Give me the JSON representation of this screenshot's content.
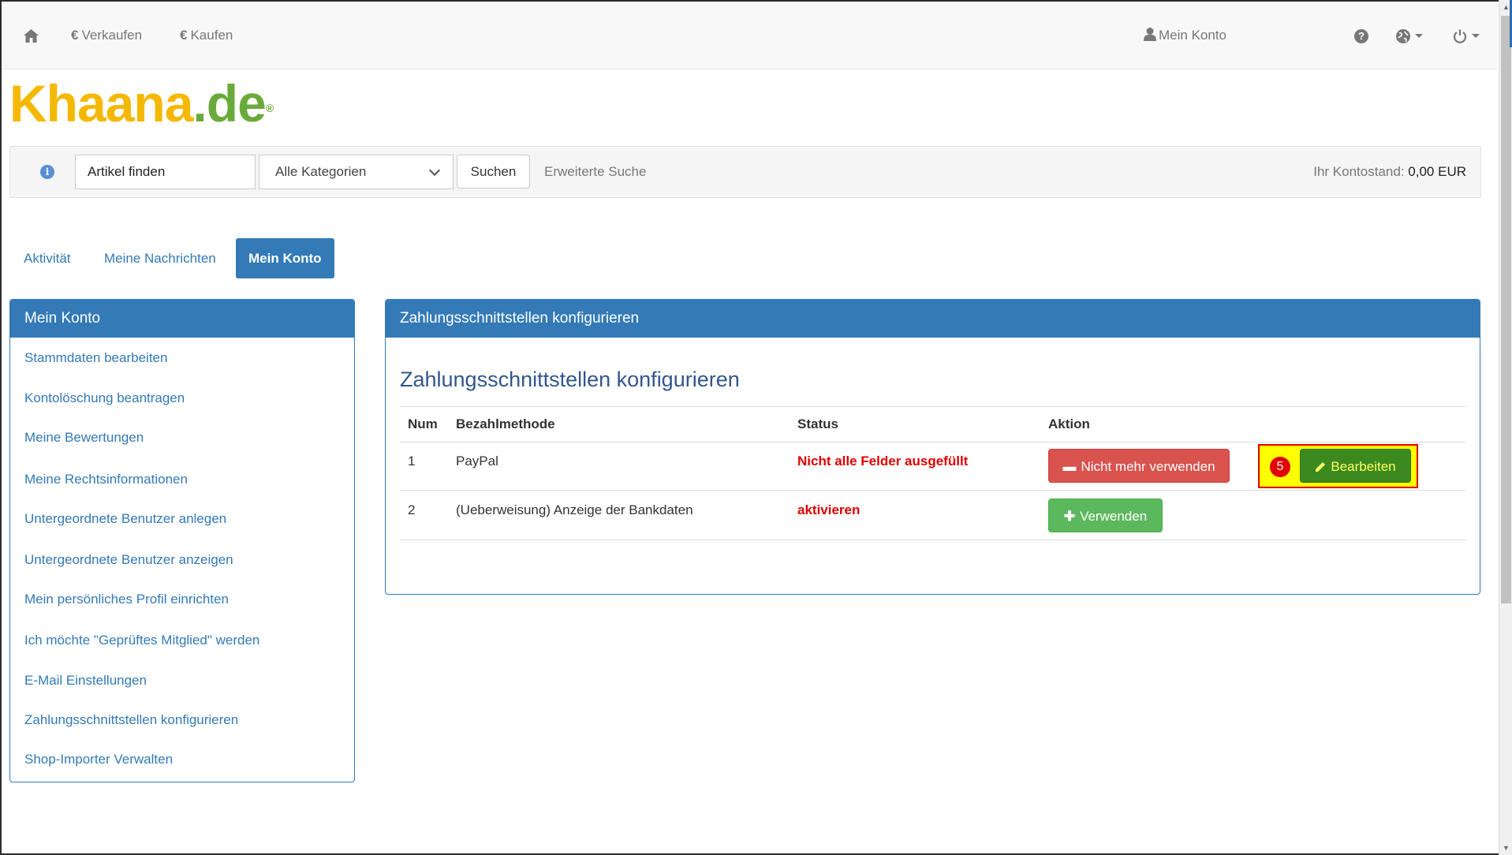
{
  "navbar": {
    "home_icon": "home-icon",
    "sell_label": "Verkaufen",
    "buy_label": "Kaufen",
    "currency_symbol": "€",
    "account_label": "Mein Konto",
    "help_icon": "question-icon",
    "language_icon": "globe-icon",
    "power_icon": "power-icon"
  },
  "logo": {
    "part1": "Khaana",
    "part2": ".de",
    "reg": "®"
  },
  "search": {
    "placeholder": "Artikel finden",
    "value": "Artikel finden",
    "category_selected": "Alle Kategorien",
    "button_label": "Suchen",
    "advanced_label": "Erweiterte Suche",
    "balance_label": "Ihr Kontostand:",
    "balance_value": "0,00 EUR"
  },
  "tabs": [
    {
      "label": "Aktivität",
      "active": false
    },
    {
      "label": "Meine Nachrichten",
      "active": false
    },
    {
      "label": "Mein Konto",
      "active": true
    }
  ],
  "sidebar": {
    "title": "Mein Konto",
    "items": [
      "Stammdaten bearbeiten",
      "Kontolöschung beantragen",
      "Meine Bewertungen",
      "Meine Rechtsinformationen",
      "Untergeordnete Benutzer anlegen",
      "Untergeordnete Benutzer anzeigen",
      "Mein persönliches Profil einrichten",
      "Ich möchte \"Geprüftes Mitglied\" werden",
      "E-Mail Einstellungen",
      "Zahlungsschnittstellen konfigurieren",
      "Shop-Importer Verwalten"
    ]
  },
  "main": {
    "panel_title": "Zahlungsschnittstellen konfigurieren",
    "heading": "Zahlungsschnittstellen konfigurieren",
    "columns": [
      "Num",
      "Bezahlmethode",
      "Status",
      "Aktion"
    ],
    "rows": [
      {
        "num": "1",
        "method": "PayPal",
        "status": "Nicht alle Felder ausgefüllt",
        "action_label": "Nicht mehr verwenden",
        "edit_label": "Bearbeiten"
      },
      {
        "num": "2",
        "method": "(Ueberweisung) Anzeige der Bankdaten",
        "status": "aktivieren",
        "action_label": "Verwenden"
      }
    ],
    "step_badge": "5"
  },
  "colors": {
    "primary": "#337ab7",
    "danger": "#d9534f",
    "success": "#5cb85c",
    "status_red": "#e00000",
    "highlight": "#ffff00"
  }
}
